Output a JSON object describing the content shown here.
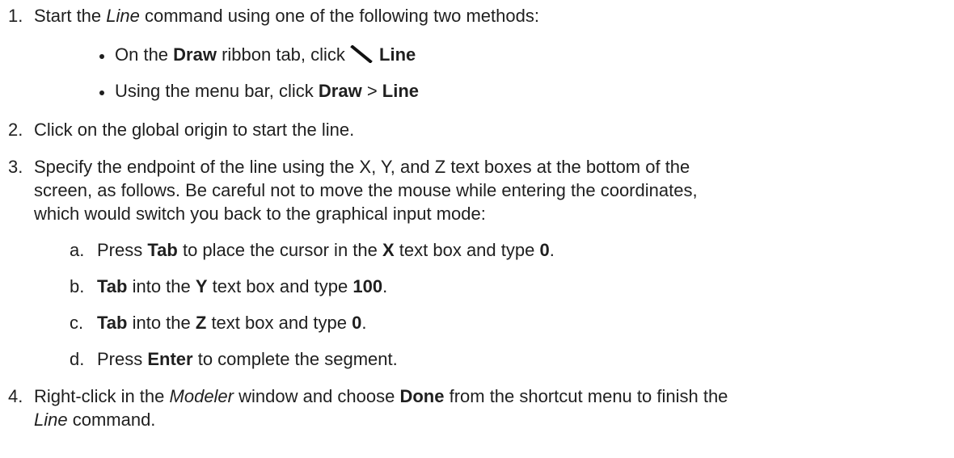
{
  "steps": {
    "s1": {
      "num": "1.",
      "t1": "Start the ",
      "t2": "Line",
      "t3": " command using one of the following two methods:"
    },
    "b1": {
      "t1": "On the ",
      "t2": "Draw",
      "t3": " ribbon tab, click ",
      "t4": "Line"
    },
    "b2": {
      "t1": "Using the menu bar, click ",
      "t2": "Draw",
      "t3": " > ",
      "t4": "Line"
    },
    "s2": {
      "num": "2.",
      "t1": "Click on the global origin to start the line."
    },
    "s3": {
      "num": "3.",
      "l1": "Specify the endpoint of the line using the X, Y, and Z text boxes at the bottom of the",
      "l2": "screen, as follows. Be careful not to move the mouse while entering the coordinates,",
      "l3": "which would switch you back to the graphical input mode:"
    },
    "sa": {
      "num": "a.",
      "t1": "Press ",
      "t2": "Tab",
      "t3": " to place the cursor in the ",
      "t4": "X",
      "t5": " text box and type ",
      "t6": "0",
      "t7": "."
    },
    "sb": {
      "num": "b.",
      "t1": "Tab",
      "t2": " into the ",
      "t3": "Y",
      "t4": " text box and type ",
      "t5": "100",
      "t6": "."
    },
    "sc": {
      "num": "c.",
      "t1": "Tab",
      "t2": " into the ",
      "t3": "Z",
      "t4": " text box and type ",
      "t5": "0",
      "t6": "."
    },
    "sd": {
      "num": "d.",
      "t1": "Press ",
      "t2": "Enter",
      "t3": " to complete the segment."
    },
    "s4": {
      "num": "4.",
      "t1": "Right-click in the ",
      "t2": "Modeler",
      "t3": " window and choose ",
      "t4": "Done",
      "t5": " from the shortcut menu to finish the",
      "t6": "Line",
      "t7": " command."
    }
  },
  "icons": {
    "line_tool": "line-tool-icon"
  }
}
